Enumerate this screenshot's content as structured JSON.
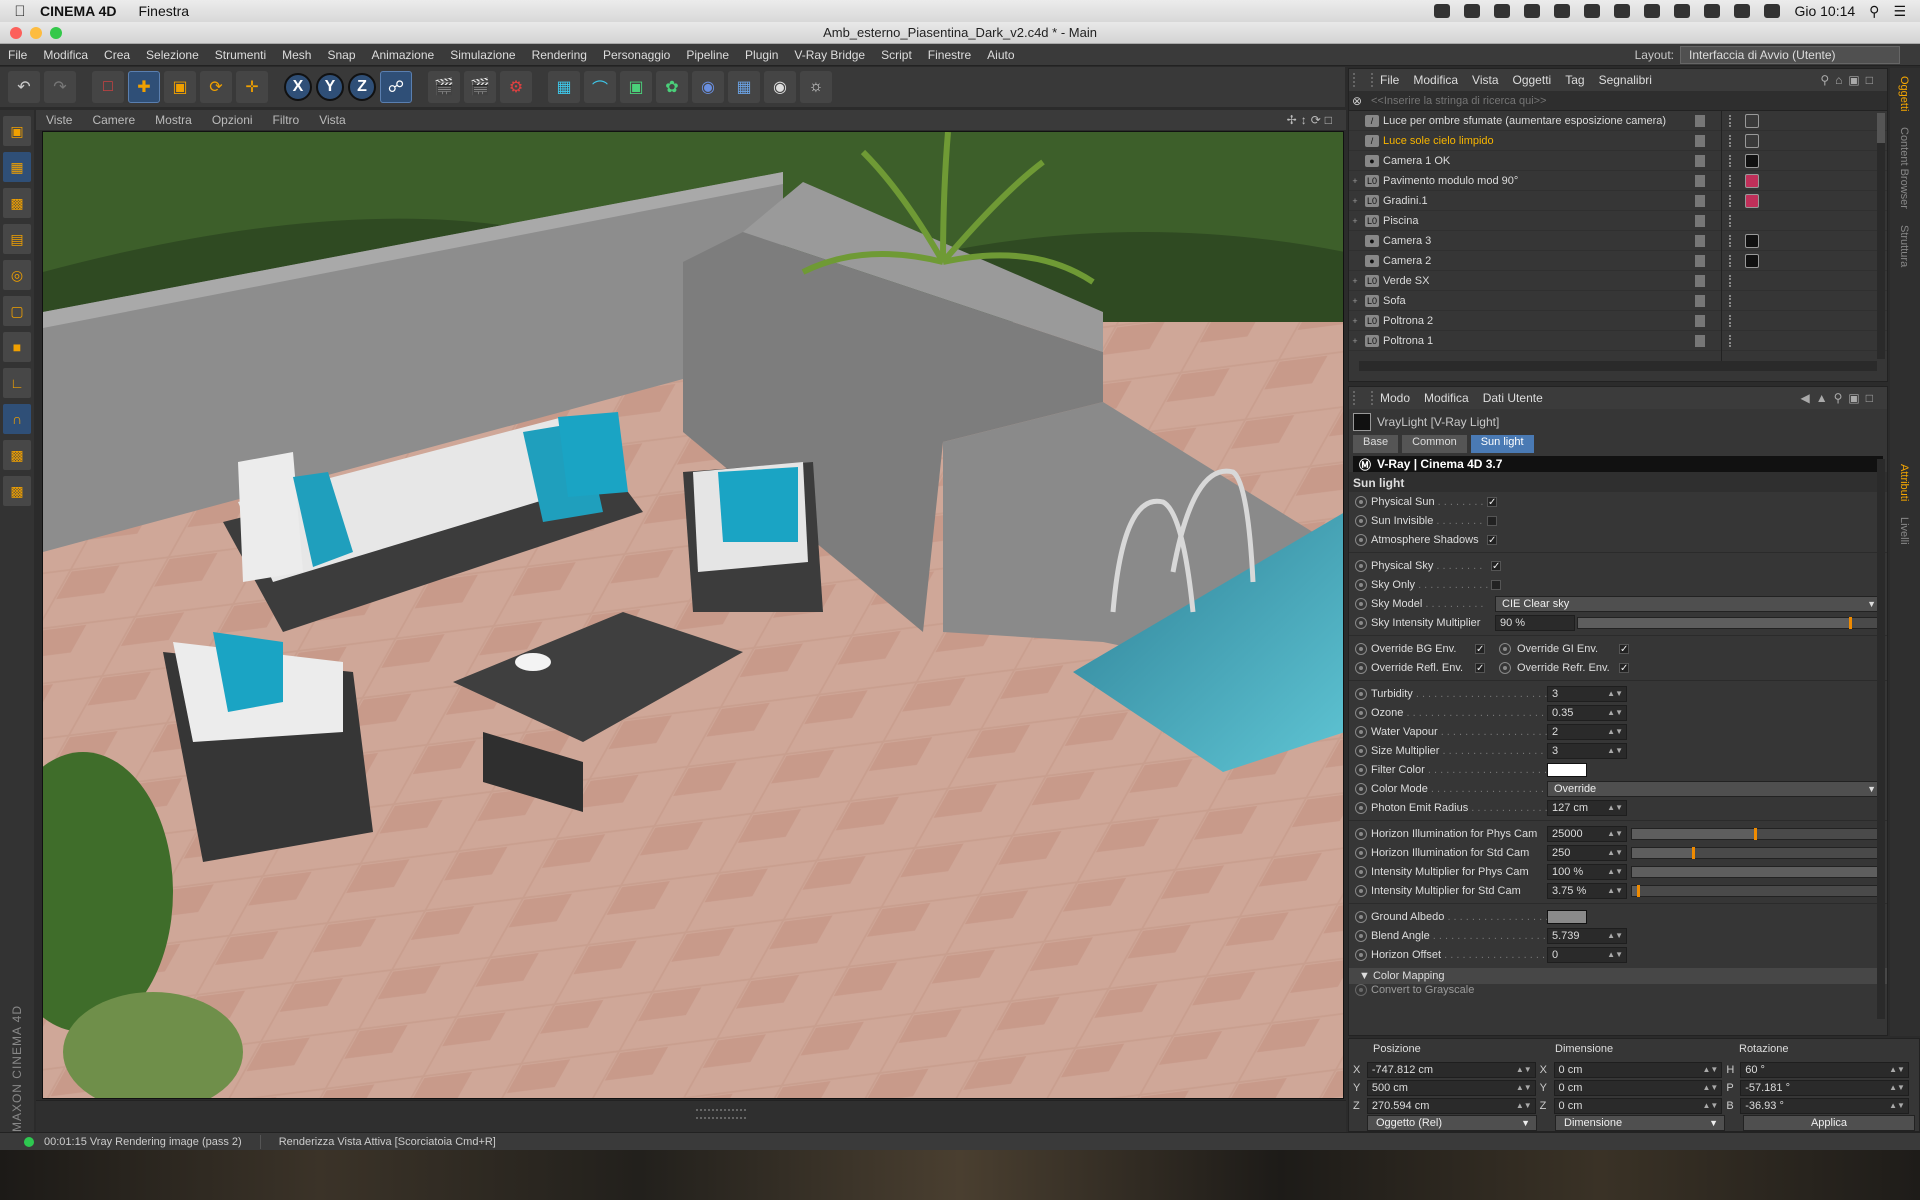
{
  "macos": {
    "app_name": "CINEMA 4D",
    "menu": "Finestra",
    "clock": "Gio 10:14"
  },
  "window": {
    "title": "Amb_esterno_Piasentina_Dark_v2.c4d * - Main"
  },
  "app_menu": [
    "File",
    "Modifica",
    "Crea",
    "Selezione",
    "Strumenti",
    "Mesh",
    "Snap",
    "Animazione",
    "Simulazione",
    "Rendering",
    "Personaggio",
    "Pipeline",
    "Plugin",
    "V-Ray Bridge",
    "Script",
    "Finestre",
    "Aiuto"
  ],
  "layout": {
    "label": "Layout:",
    "value": "Interfaccia di Avvio (Utente)"
  },
  "toolbar": {
    "axis_x": "X",
    "axis_y": "Y",
    "axis_z": "Z"
  },
  "viewport": {
    "menu": [
      "Viste",
      "Camere",
      "Mostra",
      "Opzioni",
      "Filtro",
      "Vista"
    ]
  },
  "brand": "MAXON CINEMA 4D",
  "status": {
    "render": "00:01:15 Vray Rendering image (pass 2)",
    "hint": "Renderizza Vista Attiva [Scorciatoia Cmd+R]"
  },
  "object_manager": {
    "menu": [
      "File",
      "Modifica",
      "Vista",
      "Oggetti",
      "Tag",
      "Segnalibri"
    ],
    "search_placeholder": "<<Inserire la stringa di ricerca qui>>",
    "objects": [
      {
        "name": "Luce per ombre sfumate (aumentare esposizione camera)",
        "expandable": false,
        "icon": "light",
        "selected": false,
        "tag": "#3a3a3a"
      },
      {
        "name": "Luce sole cielo limpido",
        "expandable": false,
        "icon": "light",
        "selected": true,
        "tag": "#3a3a3a"
      },
      {
        "name": "Camera 1 OK",
        "expandable": false,
        "icon": "camera",
        "selected": false,
        "tag": "#111111"
      },
      {
        "name": "Pavimento modulo mod 90°",
        "expandable": true,
        "icon": "null",
        "selected": false,
        "tag": "#c0305a"
      },
      {
        "name": "Gradini.1",
        "expandable": true,
        "icon": "null",
        "selected": false,
        "tag": "#c0305a"
      },
      {
        "name": "Piscina",
        "expandable": true,
        "icon": "null",
        "selected": false,
        "tag": ""
      },
      {
        "name": "Camera 3",
        "expandable": false,
        "icon": "camera",
        "selected": false,
        "tag": "#111111"
      },
      {
        "name": "Camera 2",
        "expandable": false,
        "icon": "camera",
        "selected": false,
        "tag": "#111111"
      },
      {
        "name": "Verde SX",
        "expandable": true,
        "icon": "null",
        "selected": false,
        "tag": ""
      },
      {
        "name": "Sofa",
        "expandable": true,
        "icon": "null",
        "selected": false,
        "tag": ""
      },
      {
        "name": "Poltrona 2",
        "expandable": true,
        "icon": "null",
        "selected": false,
        "tag": ""
      },
      {
        "name": "Poltrona 1",
        "expandable": true,
        "icon": "null",
        "selected": false,
        "tag": ""
      }
    ]
  },
  "attributes": {
    "menu": [
      "Modo",
      "Modifica",
      "Dati Utente"
    ],
    "object_title": "VrayLight [V-Ray Light]",
    "tabs": [
      "Base",
      "Common",
      "Sun light"
    ],
    "active_tab": "Sun light",
    "vray_bar": "V-Ray | Cinema 4D  3.7",
    "section": "Sun light",
    "physical_sun": "Physical Sun",
    "sun_invisible": "Sun Invisible",
    "atmosphere_shadows": "Atmosphere Shadows",
    "physical_sky": "Physical Sky",
    "sky_only": "Sky Only",
    "sky_model": {
      "label": "Sky Model",
      "value": "CIE Clear sky"
    },
    "sky_intensity": {
      "label": "Sky Intensity Multiplier",
      "value": "90 %",
      "level": 0.9
    },
    "override_bg": "Override BG Env.",
    "override_gi": "Override GI Env.",
    "override_refl": "Override Refl. Env.",
    "override_refr": "Override Refr. Env.",
    "turbidity": {
      "label": "Turbidity",
      "value": "3"
    },
    "ozone": {
      "label": "Ozone",
      "value": "0.35"
    },
    "water_vapour": {
      "label": "Water Vapour",
      "value": "2"
    },
    "size_multiplier": {
      "label": "Size Multiplier",
      "value": "3"
    },
    "filter_color": {
      "label": "Filter Color",
      "color": "#ffffff"
    },
    "color_mode": {
      "label": "Color Mode",
      "value": "Override"
    },
    "photon_radius": {
      "label": "Photon Emit Radius",
      "value": "127 cm"
    },
    "horizon_phys": {
      "label": "Horizon Illumination for Phys Cam",
      "value": "25000",
      "level": 0.5
    },
    "horizon_std": {
      "label": "Horizon Illumination for Std Cam",
      "value": "250",
      "level": 0.25
    },
    "intensity_phys": {
      "label": "Intensity Multiplier for Phys Cam",
      "value": "100 %",
      "level": 1.0
    },
    "intensity_std": {
      "label": "Intensity Multiplier for Std Cam",
      "value": "3.75 %",
      "level": 0.03
    },
    "ground_albedo": {
      "label": "Ground Albedo",
      "color": "#8a8a8a"
    },
    "blend_angle": {
      "label": "Blend Angle",
      "value": "5.739"
    },
    "horizon_offset": {
      "label": "Horizon Offset",
      "value": "0"
    },
    "color_mapping": "Color Mapping",
    "convert_grayscale": "Convert to Grayscale"
  },
  "coordinates": {
    "headers": {
      "position": "Posizione",
      "size": "Dimensione",
      "rotation": "Rotazione"
    },
    "rows": [
      {
        "axis": "X",
        "pos": "-747.812 cm",
        "size_axis": "X",
        "size": "0 cm",
        "rot_axis": "H",
        "rot": "60 °"
      },
      {
        "axis": "Y",
        "pos": "500 cm",
        "size_axis": "Y",
        "size": "0 cm",
        "rot_axis": "P",
        "rot": "-57.181 °"
      },
      {
        "axis": "Z",
        "pos": "270.594 cm",
        "size_axis": "Z",
        "size": "0 cm",
        "rot_axis": "B",
        "rot": "-36.93 °"
      }
    ],
    "mode": "Oggetto (Rel)",
    "size_mode": "Dimensione",
    "apply": "Applica"
  },
  "side_tabs": [
    "Oggetti",
    "Content Browser",
    "Struttura",
    "Attributi",
    "Livelli"
  ]
}
